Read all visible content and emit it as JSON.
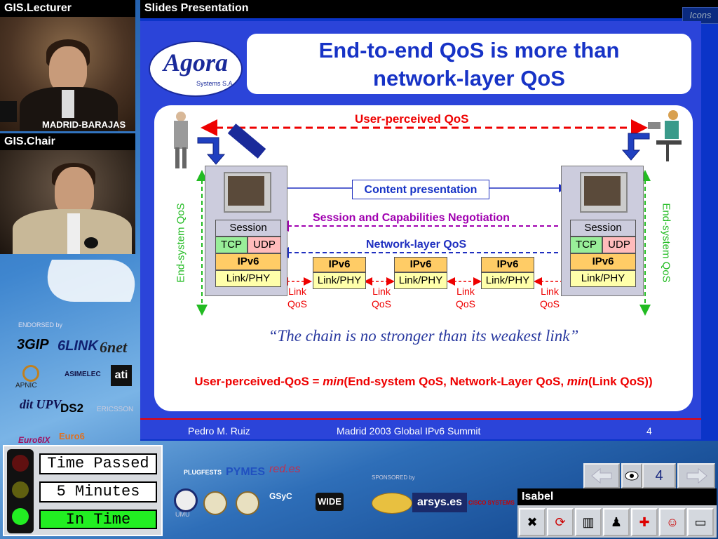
{
  "lecturer_window": {
    "title": "GIS.Lecturer",
    "caption": "MADRID-BARAJAS"
  },
  "chair_window": {
    "title": "GIS.Chair"
  },
  "slides_window": {
    "title": "Slides Presentation",
    "icons_label": "Icons"
  },
  "slide": {
    "logo": {
      "name": "Agora",
      "sub": "Systems S.A."
    },
    "title_line1": "End-to-end QoS is more than",
    "title_line2": "network-layer QoS",
    "user_perceived": "User-perceived QoS",
    "content_presentation": "Content presentation",
    "session_negotiation": "Session and Capabilities Negotiation",
    "network_layer_qos": "Network-layer QoS",
    "end_system_qos": "End-system QoS",
    "stack_left": {
      "session": "Session",
      "tcp": "TCP",
      "udp": "UDP",
      "ipv6": "IPv6",
      "linkphy": "Link/PHY"
    },
    "stack_right": {
      "session": "Session",
      "tcp": "TCP",
      "udp": "UDP",
      "ipv6": "IPv6",
      "linkphy": "Link/PHY"
    },
    "routers": [
      {
        "ipv6": "IPv6",
        "linkphy": "Link/PHY"
      },
      {
        "ipv6": "IPv6",
        "linkphy": "Link/PHY"
      },
      {
        "ipv6": "IPv6",
        "linkphy": "Link/PHY"
      }
    ],
    "link_qos": [
      {
        "l1": "Link",
        "l2": "QoS"
      },
      {
        "l1": "Link",
        "l2": "QoS"
      },
      {
        "l1": "Link",
        "l2": "QoS"
      },
      {
        "l1": "Link",
        "l2": "QoS"
      }
    ],
    "quote": "“The chain is no stronger than its weakest link”",
    "formula_a": "User-perceived-QoS = ",
    "formula_min1": "min",
    "formula_b": "(End-system QoS, Network-Layer QoS, ",
    "formula_min2": "min",
    "formula_c": "(Link QoS))",
    "footer_author": "Pedro M. Ruiz",
    "footer_event": "Madrid 2003 Global IPv6 Summit",
    "footer_page": "4"
  },
  "sponsors": {
    "endorsed_by": "ENDORSED by",
    "logos_left": [
      "3GIP",
      "6LINK",
      "6net",
      "APNIC",
      "ASIMELEC",
      "ati",
      "dit UPV",
      "DS2",
      "ERICSSON",
      "Euro6IX",
      "Euro6"
    ],
    "logos_bottom": [
      "PLUGFESTS",
      "PYMES",
      "red.es",
      "UMU",
      "WIDE",
      "arsys.es",
      "GSyC"
    ],
    "sponsored_by": "SPONSORED by",
    "cisco": "CISCO SYSTEMS"
  },
  "timer": {
    "line1": "Time Passed",
    "line2": "5 Minutes",
    "line3": "In Time"
  },
  "nav": {
    "page": "4"
  },
  "isabel": {
    "title": "Isabel"
  },
  "colors": {
    "slide_blue": "#1733c6",
    "red": "#e00000",
    "purple": "#a000b0",
    "green": "#22bb22",
    "timer_green": "#22ee22"
  }
}
